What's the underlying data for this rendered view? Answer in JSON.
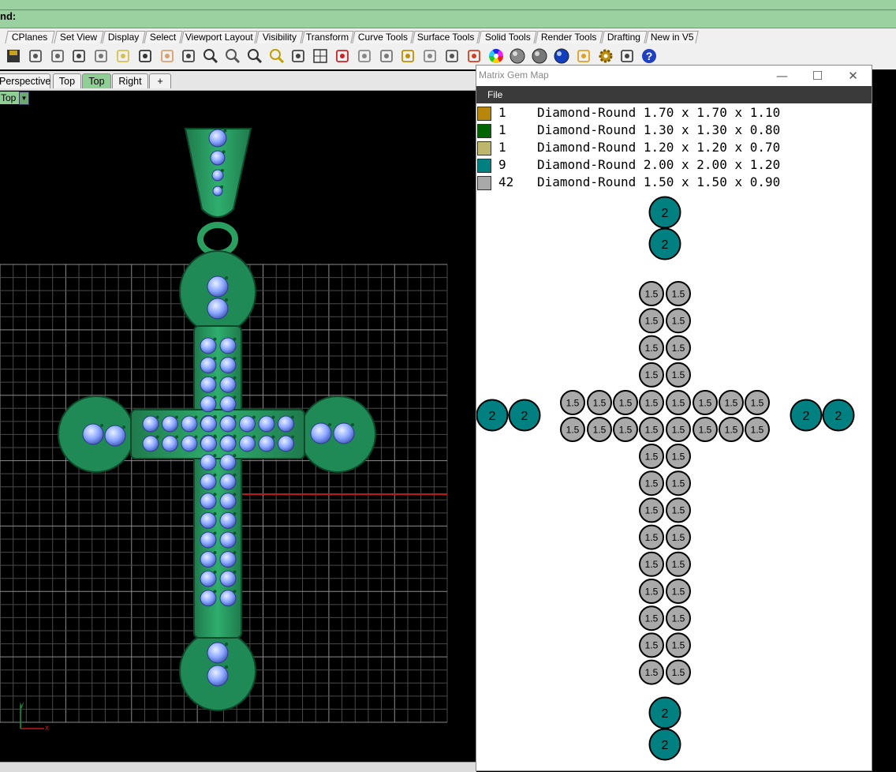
{
  "command": {
    "prompt": "nd:"
  },
  "toolbar_tabs": [
    "CPlanes",
    "Set View",
    "Display",
    "Select",
    "Viewport Layout",
    "Visibility",
    "Transform",
    "Curve Tools",
    "Surface Tools",
    "Solid Tools",
    "Render Tools",
    "Drafting",
    "New in V5"
  ],
  "toolbar_icons": [
    "save-icon",
    "print-icon",
    "copy-properties-icon",
    "cut-icon",
    "copy-icon",
    "paste-icon",
    "undo-icon",
    "pan-hand-icon",
    "move-cross-icon",
    "zoom-window-icon",
    "zoom-dynamic-icon",
    "zoom-extents-icon",
    "zoom-selected-icon",
    "rotate-view-icon",
    "four-viewports-icon",
    "car-icon",
    "hide-eye-icon",
    "show-circle-icon",
    "select-icon",
    "light-bulb-icon",
    "lock-icon",
    "layer-icon",
    "color-wheel-icon",
    "render-sphere-icon",
    "shaded-sphere-icon",
    "blue-sphere-icon",
    "render-cone-icon",
    "gear-icon",
    "grid-snap-icon",
    "help-icon"
  ],
  "viewport_tabs": [
    "Perspective",
    "Top",
    "Top",
    "Right",
    "+"
  ],
  "viewport": {
    "label": "Top",
    "axis_x": "x",
    "axis_y": "y"
  },
  "gem_window": {
    "title": "Matrix Gem Map",
    "menu_file": "File",
    "controls": {
      "minimize": "—",
      "maximize": "☐",
      "close": "✕"
    },
    "legend": [
      {
        "count": "1",
        "desc": "Diamond-Round 1.70 x 1.70 x 1.10",
        "color": "#b8860b"
      },
      {
        "count": "1",
        "desc": "Diamond-Round 1.30 x 1.30 x 0.80",
        "color": "#006400"
      },
      {
        "count": "1",
        "desc": "Diamond-Round 1.20 x 1.20 x 0.70",
        "color": "#bdb76b"
      },
      {
        "count": "9",
        "desc": "Diamond-Round 2.00 x 2.00 x 1.20",
        "color": "#008080"
      },
      {
        "count": "42",
        "desc": "Diamond-Round 1.50 x 1.50 x 0.90",
        "color": "#a9a9a9"
      }
    ],
    "large_gem_label": "2",
    "small_gem_label": "1.5",
    "large_gem_color": "#008080",
    "small_gem_color": "#a9a9a9"
  }
}
